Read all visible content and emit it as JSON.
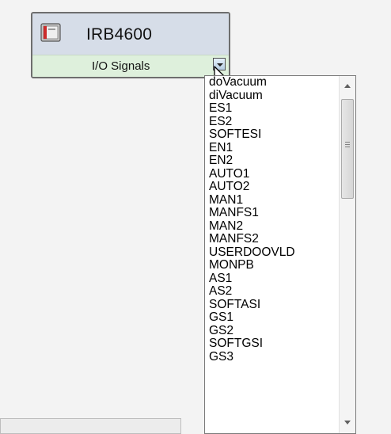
{
  "robot_block": {
    "title": "IRB4600",
    "subtitle": "I/O Signals"
  },
  "signal_list": {
    "items": [
      "doVacuum",
      "diVacuum",
      "ES1",
      "ES2",
      "SOFTESI",
      "EN1",
      "EN2",
      "AUTO1",
      "AUTO2",
      "MAN1",
      "MANFS1",
      "MAN2",
      "MANFS2",
      "USERDOOVLD",
      "MONPB",
      "AS1",
      "AS2",
      "SOFTASI",
      "GS1",
      "GS2",
      "SOFTGSI",
      "GS3"
    ]
  }
}
